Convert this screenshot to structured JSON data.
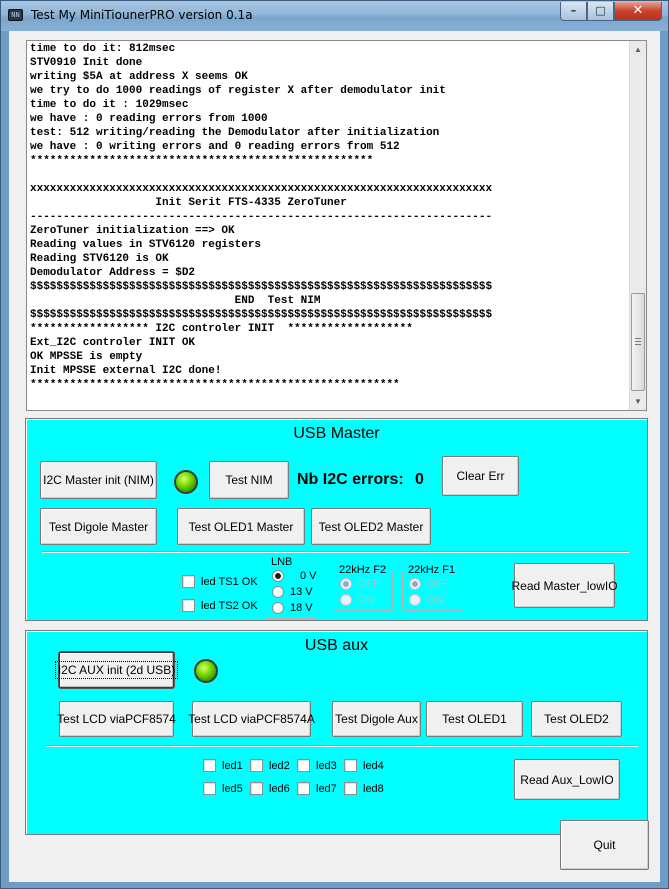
{
  "window": {
    "title": "Test My MiniTiounerPRO version 0.1a",
    "app_icon_text": "NN",
    "min_glyph": "–",
    "max_glyph": "□",
    "close_glyph": "✕",
    "icon_names": [
      "app-icon",
      "minimize-icon",
      "maximize-icon",
      "close-icon"
    ]
  },
  "log": {
    "lines": [
      "time to do it: 812msec",
      "STV0910 Init done",
      "writing $5A at address X seems OK",
      "we try to do 1000 readings of register X after demodulator init",
      "time to do it : 1029msec",
      "we have : 0 reading errors from 1000",
      "test: 512 writing/reading the Demodulator after initialization",
      "we have : 0 writing errors and 0 reading errors from 512",
      "****************************************************",
      "",
      "xxxxxxxxxxxxxxxxxxxxxxxxxxxxxxxxxxxxxxxxxxxxxxxxxxxxxxxxxxxxxxxxxxxxxx",
      "                   Init Serit FTS-4335 ZeroTuner",
      "----------------------------------------------------------------------",
      "ZeroTuner initialization ==> OK",
      "Reading values in STV6120 registers",
      "Reading STV6120 is OK",
      "Demodulator Address = $D2",
      "$$$$$$$$$$$$$$$$$$$$$$$$$$$$$$$$$$$$$$$$$$$$$$$$$$$$$$$$$$$$$$$$$$$$$$",
      "                               END  Test NIM",
      "$$$$$$$$$$$$$$$$$$$$$$$$$$$$$$$$$$$$$$$$$$$$$$$$$$$$$$$$$$$$$$$$$$$$$$",
      "****************** I2C controler INIT  *******************",
      "Ext_I2C controler INIT OK",
      "OK MPSSE is empty",
      "Init MPSSE external I2C done!",
      "********************************************************"
    ],
    "scroll_up_glyph": "▲",
    "scroll_down_glyph": "▼"
  },
  "master": {
    "title": "USB Master",
    "i2c_init": "I2C Master init (NIM)",
    "test_nim": "Test NIM",
    "errors_label": "Nb I2C errors:",
    "errors_value": "0",
    "clear_err": "Clear Err",
    "test_digole": "Test Digole Master",
    "test_oled1": "Test OLED1 Master",
    "test_oled2": "Test OLED2 Master",
    "led_ts1": "led TS1 OK",
    "led_ts2": "led TS2 OK",
    "lnb_title": "LNB",
    "lnb_options": [
      "0 V",
      "13 V",
      "18 V"
    ],
    "lnb_selected": "0 V",
    "f2_title": "22kHz F2",
    "f1_title": "22kHz F1",
    "off": "OFF",
    "on": "ON",
    "read_lowio": "Read Master_lowIO",
    "led_color": "#5fd400"
  },
  "aux": {
    "title": "USB aux",
    "i2c_init": "I2C AUX init (2d USB)",
    "test_lcd1": "Test LCD viaPCF8574",
    "test_lcd2": "Test LCD viaPCF8574A",
    "test_digole": "Test Digole Aux",
    "test_oled1": "Test OLED1",
    "test_oled2": "Test OLED2",
    "leds": [
      "led1",
      "led2",
      "led3",
      "led4",
      "led5",
      "led6",
      "led7",
      "led8"
    ],
    "read_lowio": "Read Aux_LowIO",
    "led_color": "#5fd400"
  },
  "quit": "Quit",
  "panel_color": "#00ffff"
}
